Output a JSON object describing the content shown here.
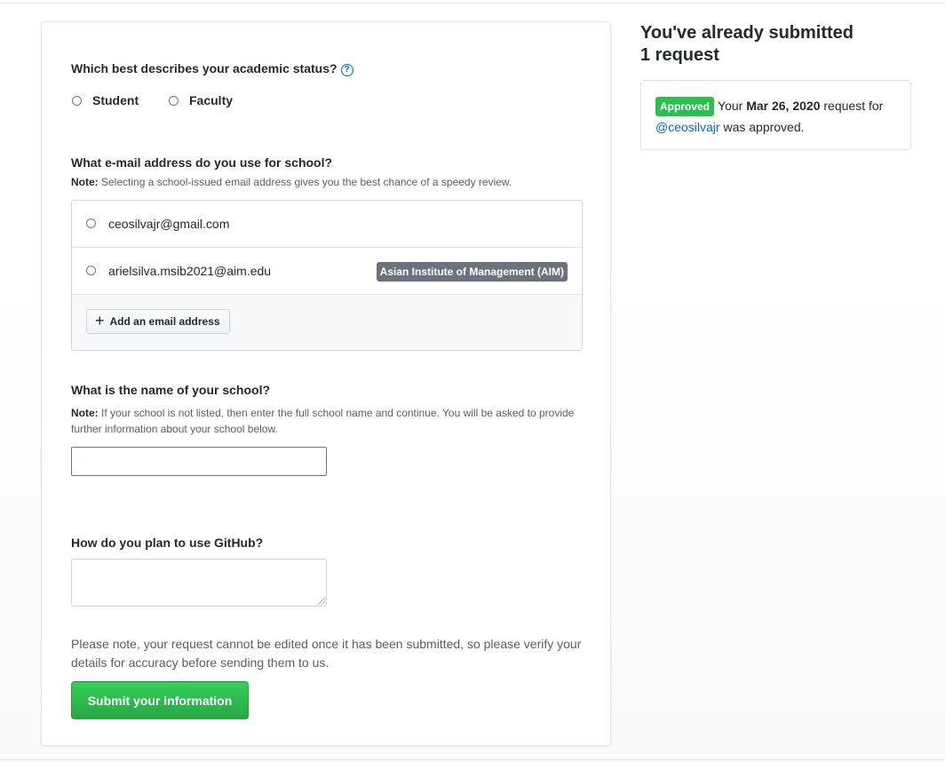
{
  "academic_status": {
    "question": "Which best describes your academic status?",
    "help_icon": "question-circle-icon",
    "options": [
      {
        "label": "Student",
        "selected": false
      },
      {
        "label": "Faculty",
        "selected": false
      }
    ]
  },
  "email": {
    "question": "What e-mail address do you use for school?",
    "note_prefix": "Note:",
    "note_text": " Selecting a school-issued email address gives you the best chance of a speedy review.",
    "addresses": [
      {
        "address": "ceosilvajr@gmail.com",
        "school": null,
        "selected": false
      },
      {
        "address": "arielsilva.msib2021@aim.edu",
        "school": "Asian Institute of Management (AIM)",
        "selected": false
      }
    ],
    "add_button_label": "Add an email address",
    "add_button_icon": "plus-icon"
  },
  "school_name": {
    "question": "What is the name of your school?",
    "note_prefix": "Note:",
    "note_text": " If your school is not listed, then enter the full school name and continue. You will be asked to provide further information about your school below.",
    "value": ""
  },
  "usage": {
    "question": "How do you plan to use GitHub?",
    "value": ""
  },
  "disclaimer": "Please note, your request cannot be edited once it has been submitted, so please verify your details for accuracy before sending them to us.",
  "submit_label": "Submit your information",
  "sidebar": {
    "title_line1": "You've already submitted",
    "title_line2": "1 request",
    "request": {
      "status": "Approved",
      "text_before": "Your ",
      "date": "Mar 26, 2020",
      "text_middle": " request for",
      "username": "@ceosilvajr",
      "text_after": " was approved."
    }
  },
  "colors": {
    "accent_link": "#0366d6",
    "approved_green": "#2cbe4e",
    "submit_green": "#28a745",
    "school_badge_gray": "#6a737d"
  }
}
